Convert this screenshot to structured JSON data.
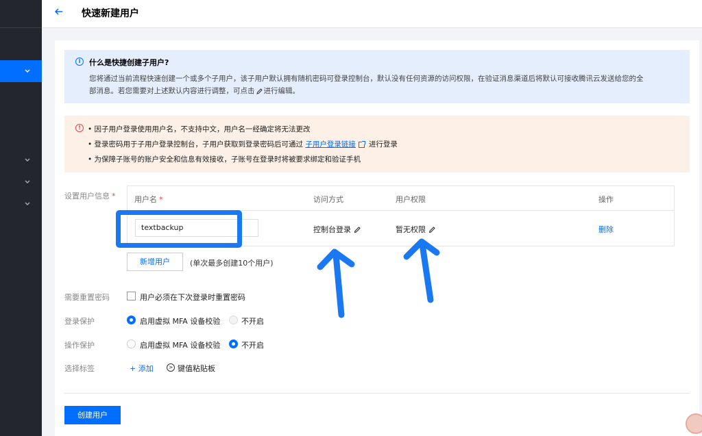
{
  "header": {
    "title": "快速新建用户"
  },
  "info": {
    "title": "什么是快捷创建子用户?",
    "body_line1": "您将通过当前流程快速创建一个或多个子用户，该子用户默认拥有随机密码可登录控制台，默认没有任何资源的访问权限，在验证消息渠道后将默认可接收腾讯云发送给您的全",
    "body_line2": "部消息。若您需要对上述默认内容进行调整，可点击",
    "body_line2_suffix": "进行编辑。"
  },
  "warning": {
    "item1": "因子用户登录使用用户名，不支持中文，用户名一经确定将无法更改",
    "item2_prefix": "登录密码用于子用户登录控制台，子用户获取到登录密码后可通过",
    "item2_link": "子用户登录链接",
    "item2_suffix": "进行登录",
    "item3": "为保障子账号的账户安全和信息有效接收，子账号在登录时将被要求绑定和验证手机"
  },
  "form": {
    "user_info_label": "设置用户信息",
    "required_mark": "*",
    "table": {
      "col_username": "用户名",
      "col_access": "访问方式",
      "col_permission": "用户权限",
      "col_action": "操作",
      "row": {
        "username": "textbackup",
        "access": "控制台登录",
        "permission": "暂无权限",
        "action": "删除"
      }
    },
    "add_user_label": "新增用户",
    "add_user_hint": "(单次最多创建10个用户)",
    "reset_pwd_label": "需要重置密码",
    "reset_pwd_option": "用户必须在下次登录时重置密码",
    "login_protect_label": "登录保护",
    "op_protect_label": "操作保护",
    "mfa_option": "启用虚拟 MFA 设备校验",
    "off_option": "不开启",
    "login_protect_value": "mfa",
    "op_protect_value": "off",
    "tags_label": "选择标签",
    "tags_add": "+ 添加",
    "tags_kv": "键值粘贴板",
    "submit_label": "创建用户"
  },
  "colors": {
    "primary": "#006eff",
    "annotation": "#1a78f0",
    "sidebar": "#23262d"
  }
}
